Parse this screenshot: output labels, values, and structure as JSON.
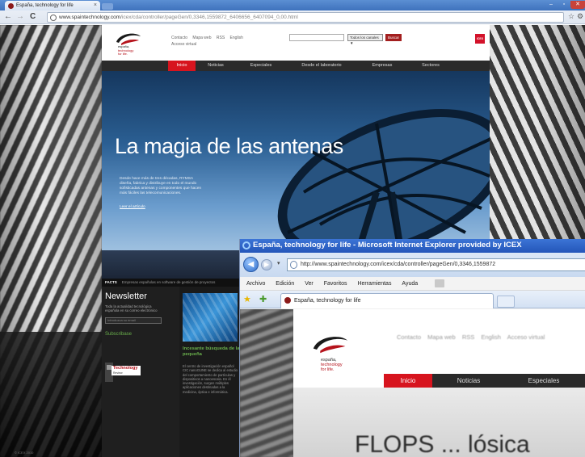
{
  "chrome": {
    "tab_title": "España, technology for life",
    "tab_close": "×",
    "url_domain": "www.spaintechnology.com",
    "url_path": "/icex/cda/controller/pageGen/0,3346,1559872_6406656_6407094_0,00.html",
    "back": "←",
    "forward": "→",
    "reload": "C",
    "star": "☆",
    "wrench": "⚙",
    "win_min": "–",
    "win_max": "▫",
    "win_close": "✕"
  },
  "site": {
    "logo_line1": "españa,",
    "logo_line2": "technology",
    "logo_line3": "for life.",
    "toplinks": [
      "Contacto",
      "Mapa web",
      "RSS",
      "English"
    ],
    "toplinks2": "Acceso virtual",
    "select_value": "Todos los canales ▼",
    "search_button": "Buscar",
    "icex_badge": "ICEX",
    "nav": [
      "Inicio",
      "Noticias",
      "Especiales",
      "Desde el laboratorio",
      "Empresas",
      "Sectores"
    ],
    "hero_title": "La magia de las antenas",
    "hero_body": "Desde hace más de tres décadas, RYMSA diseña, fabrica y distribuye en todo el mundo sofisticadas antenas y componentes que hacen más fáciles las telecomunicaciones.",
    "hero_link": "Leer el artículo",
    "facts_label": "FACTS",
    "facts_text": "Empresas españolas en software de gestión de proyectos",
    "newsletter_title": "Newsletter",
    "newsletter_text": "Toda la actualidad tecnológica española en su correo electrónico",
    "newsletter_placeholder": "Introduzca su email",
    "newsletter_subscribe": "Subscribase",
    "tech_badge_title": "Technology",
    "tech_badge_sub": "Review",
    "feature_title": "Incesante búsqueda de la pequeña",
    "feature_text": "El centro de investigación español CIC nanoGUNE se dedica al estudio del comportamiento de partículas y dispositivos a nanoescala. En él investigación, surgen múltiples aplicaciones destinadas a la medicina, óptica e informática.",
    "copyright": "© ICEX 2010"
  },
  "ie": {
    "title": "España, technology for life - Microsoft Internet Explorer provided by ICEX",
    "back": "◀",
    "forward": "▶",
    "dropdown": "▾",
    "address": "http://www.spaintechnology.com/icex/cda/controller/pageGen/0,3346,1559872",
    "menu": [
      "Archivo",
      "Edición",
      "Ver",
      "Favoritos",
      "Herramientas",
      "Ayuda"
    ],
    "fav_star": "★",
    "add_fav": "✚",
    "tab_title": "España, technology for life",
    "toplinks": [
      "Contacto",
      "Mapa web",
      "RSS",
      "English",
      "Acceso virtual"
    ],
    "logo_line1": "españa,",
    "logo_line2": "technology",
    "logo_line3": "for life.",
    "nav": [
      "Inicio",
      "Noticias",
      "Especiales"
    ],
    "hero_title": "FLOPS ... lósica"
  },
  "colors": {
    "brand_red": "#d7141e",
    "accent_green": "#6ab04c",
    "chrome_blue": "#3f72bd",
    "ie_title_blue": "#2456b9"
  }
}
